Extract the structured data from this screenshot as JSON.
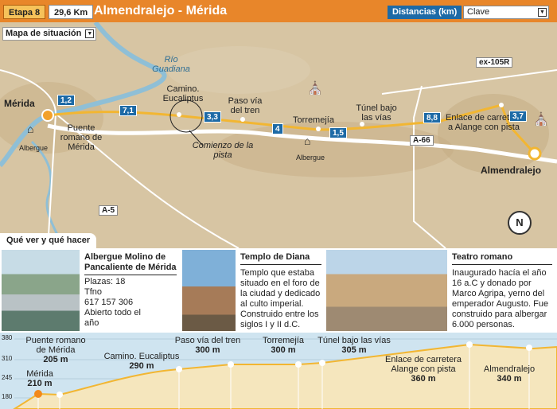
{
  "header": {
    "stage_label": "Etapa 8",
    "distance": "29,6 Km",
    "title": "Almendralejo - Mérida",
    "distances_button": "Distancias (km)",
    "key_select": "Clave"
  },
  "map": {
    "situation_label": "Mapa de situación",
    "river": "Río Guadiana",
    "places": {
      "merida": "Mérida",
      "almendralejo": "Almendralejo",
      "torremejia": "Torremejía"
    },
    "labels": {
      "puente_romano": "Puente romano de Mérida",
      "camino_eucaliptus": "Camino. Eucaliptus",
      "paso_via": "Paso vía del tren",
      "tunel": "Túnel bajo las vías",
      "enlace": "Enlace de carretera a Alange con pista",
      "comienzo": "Comienzo de la pista",
      "albergue_1": "Albergue",
      "albergue_2": "Albergue"
    },
    "roads": [
      "ex-105R",
      "A-66",
      "A-5"
    ],
    "km_markers": [
      "1,2",
      "7,1",
      "3,3",
      "4",
      "1,5",
      "8,8",
      "3,7"
    ],
    "compass": "N",
    "colors": {
      "route": "#f2b632",
      "km_box": "#1d6aa6",
      "header": "#e8862a"
    }
  },
  "poi": {
    "section_title": "Qué ver y qué hacer",
    "items": [
      {
        "title": "Albergue Molino de Pancaliente de Mérida",
        "lines": [
          "Plazas: 18",
          "Tfno",
          "617 157 306",
          "Abierto todo el",
          "año"
        ]
      },
      {
        "title": "Templo de Diana",
        "lines": [
          "Templo que estaba",
          "situado en el foro de",
          "la ciudad y dedicado",
          "al culto imperial.",
          "Construido entre los",
          "siglos I y II d.C."
        ]
      },
      {
        "title": "Teatro romano",
        "lines": [
          "Inaugurado hacía el año",
          "16 a.C y donado por",
          "Marco Agripa, yerno del",
          "emperador Augusto. Fue",
          "construido para albergar",
          "6.000 personas."
        ]
      }
    ]
  },
  "profile": {
    "y_ticks": [
      "380",
      "310",
      "245",
      "180"
    ],
    "points": [
      {
        "name": "Mérida",
        "elev": "210 m"
      },
      {
        "name": "Puente romano de Mérida",
        "elev": "205 m"
      },
      {
        "name": "Camino. Eucaliptus",
        "elev": "290 m"
      },
      {
        "name": "Paso vía del tren",
        "elev": "300 m"
      },
      {
        "name": "Torremejía",
        "elev": "300 m"
      },
      {
        "name": "Túnel bajo las vías",
        "elev": "305 m"
      },
      {
        "name": "Enlace de carretera Alange con pista",
        "elev": "360 m"
      },
      {
        "name": "Almendralejo",
        "elev": "340 m"
      }
    ]
  }
}
